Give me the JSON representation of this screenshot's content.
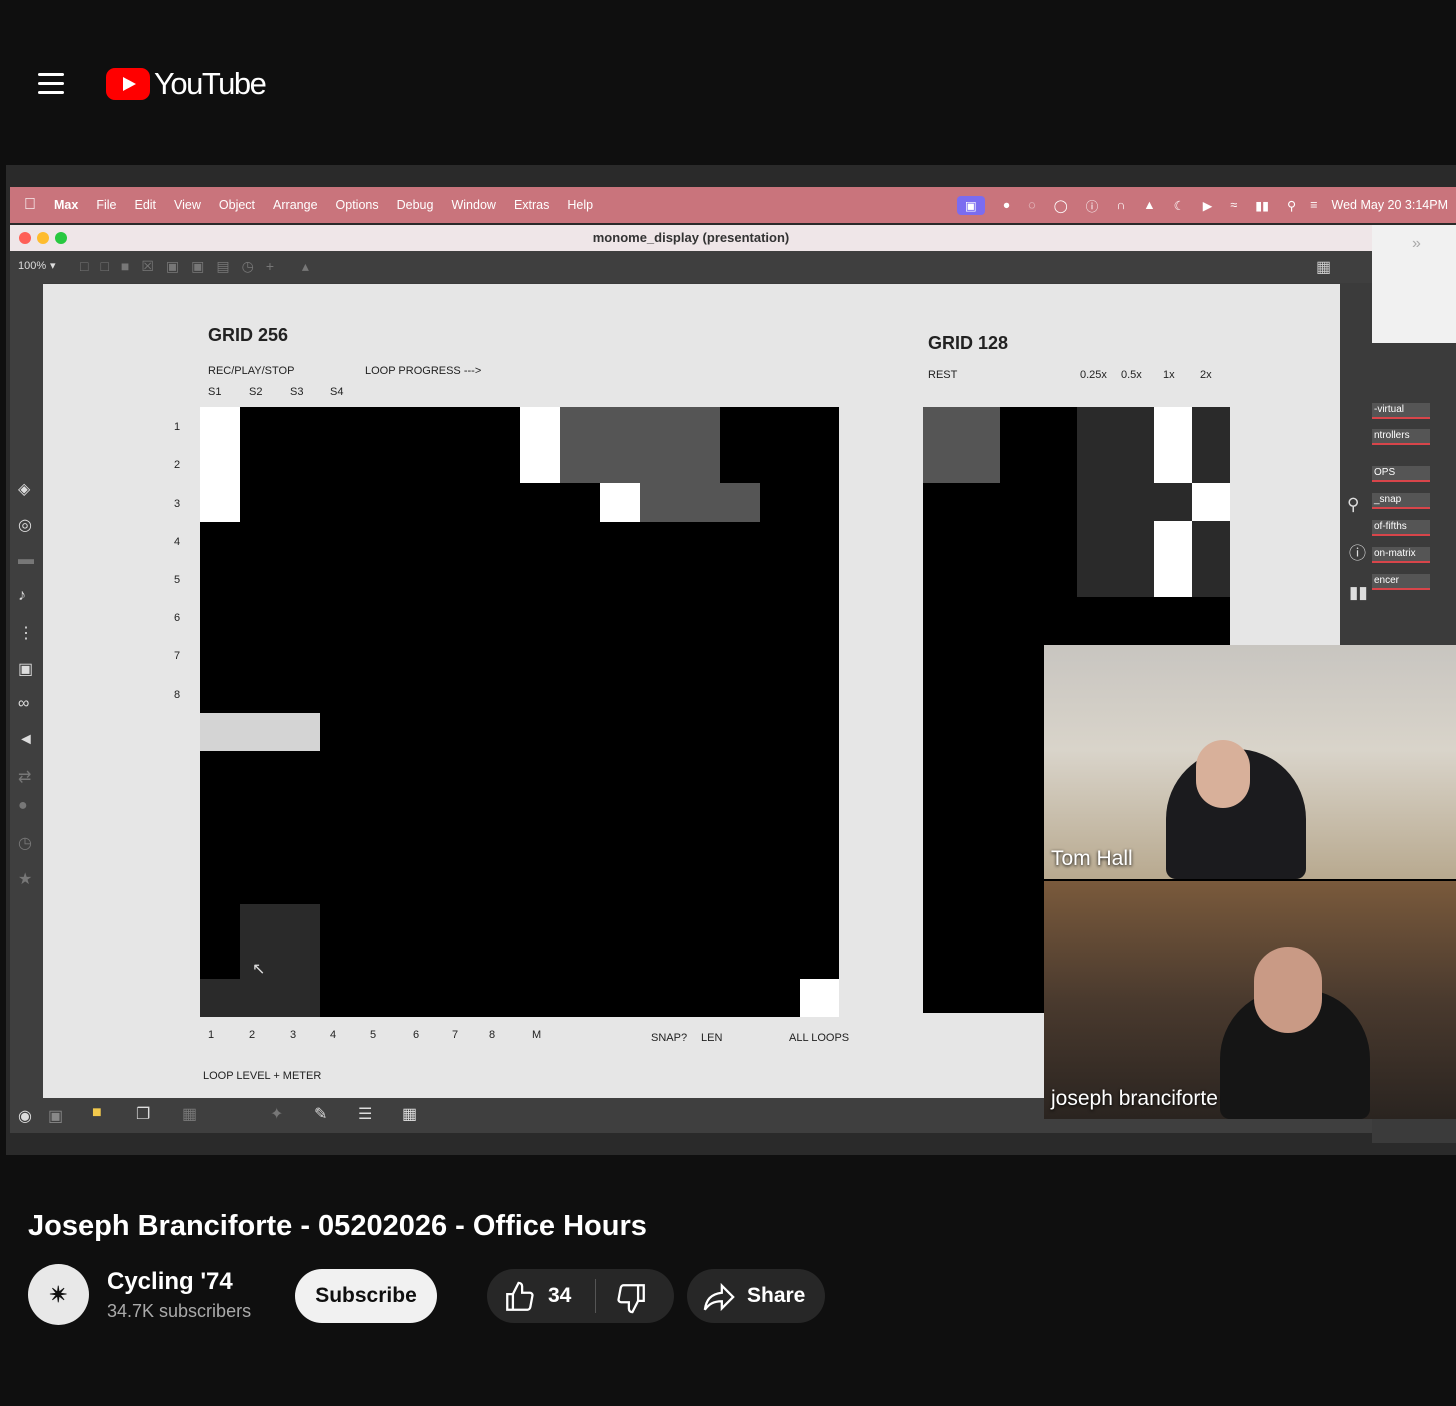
{
  "header": {
    "logo_text": "YouTube"
  },
  "mac_menubar": {
    "items": [
      "Max",
      "File",
      "Edit",
      "View",
      "Object",
      "Arrange",
      "Options",
      "Debug",
      "Window",
      "Extras",
      "Help"
    ],
    "datetime": "Wed May 20  3:14PM"
  },
  "max_window": {
    "title": "monome_display (presentation)",
    "zoom": "100%"
  },
  "grid256": {
    "title": "GRID 256",
    "label_rec": "REC/PLAY/STOP",
    "label_progress": "LOOP PROGRESS --->",
    "cols_top": [
      "S1",
      "S2",
      "S3",
      "S4"
    ],
    "rows": [
      "1",
      "2",
      "3",
      "4",
      "5",
      "6",
      "7",
      "8"
    ],
    "cols_bottom": [
      "1",
      "2",
      "3",
      "4",
      "5",
      "6",
      "7",
      "8",
      "M"
    ],
    "label_snap": "SNAP?",
    "label_len": "LEN",
    "label_all": "ALL LOOPS",
    "label_footer": "LOOP LEVEL + METER"
  },
  "grid128": {
    "title": "GRID 128",
    "label_rest": "REST",
    "speeds": [
      "0.25x",
      "0.5x",
      "1x",
      "2x"
    ]
  },
  "side_panel": {
    "items": [
      "-virtual",
      "ntrollers",
      "OPS",
      "_snap",
      "of-fifths",
      "on-matrix",
      "encer"
    ]
  },
  "webcam": {
    "participants": [
      "Tom Hall",
      "joseph branciforte"
    ]
  },
  "video_info": {
    "title": "Joseph Branciforte - 05202026 - Office Hours",
    "channel": "Cycling '74",
    "subscribers": "34.7K subscribers",
    "subscribe_label": "Subscribe",
    "likes": "34",
    "share_label": "Share"
  }
}
